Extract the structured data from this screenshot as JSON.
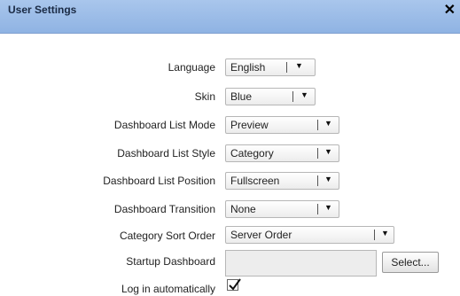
{
  "dialog": {
    "title": "User Settings",
    "close_glyph": "✕"
  },
  "fields": {
    "language": {
      "label": "Language",
      "value": "English"
    },
    "skin": {
      "label": "Skin",
      "value": "Blue"
    },
    "list_mode": {
      "label": "Dashboard List Mode",
      "value": "Preview"
    },
    "list_style": {
      "label": "Dashboard List Style",
      "value": "Category"
    },
    "list_position": {
      "label": "Dashboard List Position",
      "value": "Fullscreen"
    },
    "transition": {
      "label": "Dashboard Transition",
      "value": "None"
    },
    "sort_order": {
      "label": "Category Sort Order",
      "value": "Server Order"
    },
    "startup": {
      "label": "Startup Dashboard",
      "value": "",
      "button": "Select..."
    },
    "auto_login": {
      "label": "Log in automatically",
      "checked": true
    }
  },
  "icons": {
    "dropdown": "chevron-down-icon",
    "close": "close-icon",
    "check": "checkmark-icon"
  }
}
